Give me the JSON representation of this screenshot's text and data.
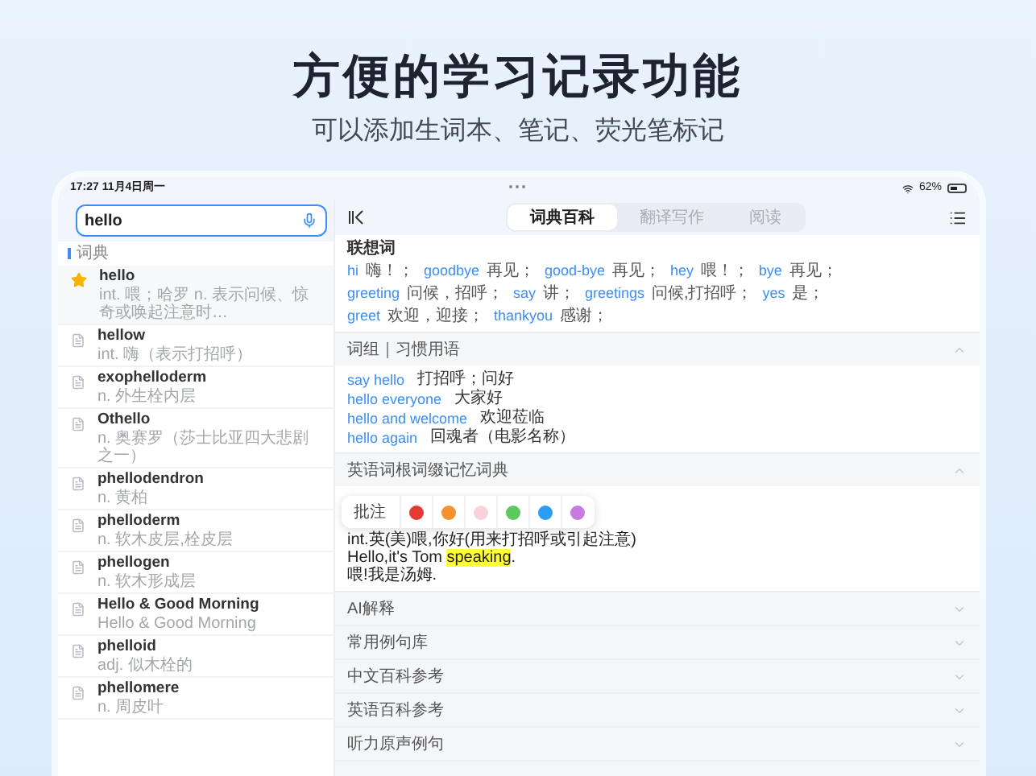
{
  "header": {
    "title": "方便的学习记录功能",
    "subtitle": "可以添加生词本、笔记、荧光笔标记"
  },
  "status": {
    "time": "17:27",
    "date": "11月4日周一",
    "battery": "62%"
  },
  "search": {
    "value": "hello"
  },
  "list_label": "词典",
  "entries": [
    {
      "word": "hello",
      "definition": "int. 喂；哈罗 n. 表示问候、惊奇或唤起注意时…",
      "starred": true
    },
    {
      "word": "hellow",
      "definition": "int. 嗨（表示打招呼）",
      "starred": false
    },
    {
      "word": "exophelloderm",
      "definition": "n. 外生栓内层",
      "starred": false
    },
    {
      "word": "Othello",
      "definition": "n. 奥赛罗（莎士比亚四大悲剧之一）",
      "starred": false
    },
    {
      "word": "phellodendron",
      "definition": "n. 黄柏",
      "starred": false
    },
    {
      "word": "phelloderm",
      "definition": "n. 软木皮层,栓皮层",
      "starred": false
    },
    {
      "word": "phellogen",
      "definition": "n. 软木形成层",
      "starred": false
    },
    {
      "word": "Hello & Good Morning",
      "definition": "Hello & Good Morning",
      "starred": false
    },
    {
      "word": "phelloid",
      "definition": "adj. 似木栓的",
      "starred": false
    },
    {
      "word": "phellomere",
      "definition": "n. 周皮叶",
      "starred": false
    }
  ],
  "tabs": [
    {
      "label": "词典百科",
      "selected": true
    },
    {
      "label": "翻译写作",
      "selected": false
    },
    {
      "label": "阅读",
      "selected": false
    }
  ],
  "associations": {
    "title": "联想词",
    "items": [
      {
        "word": "hi",
        "meaning": "嗨！；"
      },
      {
        "word": "goodbye",
        "meaning": "再见；"
      },
      {
        "word": "good-bye",
        "meaning": "再见；"
      },
      {
        "word": "hey",
        "meaning": "喂！；"
      },
      {
        "word": "bye",
        "meaning": "再见；"
      },
      {
        "word": "greeting",
        "meaning": "问候，招呼；"
      },
      {
        "word": "say",
        "meaning": "讲；"
      },
      {
        "word": "greetings",
        "meaning": "问候,打招呼；"
      },
      {
        "word": "yes",
        "meaning": "是；"
      },
      {
        "word": "greet",
        "meaning": "欢迎，迎接；"
      },
      {
        "word": "thankyou",
        "meaning": "感谢；"
      }
    ]
  },
  "sections": [
    {
      "kind": "phrases",
      "title": "词组｜习惯用语",
      "expanded": true,
      "items": [
        {
          "phrase": "say hello",
          "meaning": "打招呼；问好"
        },
        {
          "phrase": "hello everyone",
          "meaning": "大家好"
        },
        {
          "phrase": "hello and welcome",
          "meaning": "欢迎莅临"
        },
        {
          "phrase": "hello again",
          "meaning": "回魂者（电影名称）"
        }
      ]
    },
    {
      "kind": "notes",
      "title": "英语词根词缀记忆词典",
      "expanded": true,
      "toolbar": {
        "label": "批注",
        "colors": [
          {
            "color": "#e53935"
          },
          {
            "color": "#f5922f"
          },
          {
            "color": "#f9d3dc"
          },
          {
            "color": "#5cc95c"
          },
          {
            "color": "#2a9df4"
          },
          {
            "color": "#c77be0"
          }
        ]
      },
      "lines": [
        [
          {
            "text": "int.英(美)喂,你好(用来打招呼或引起注意)",
            "highlighted": false
          }
        ],
        [
          {
            "text": "Hello,it's Tom ",
            "highlighted": false
          },
          {
            "text": "speaking",
            "highlighted": true
          },
          {
            "text": ".",
            "highlighted": false
          }
        ],
        [
          {
            "text": "喂!我是汤姆.",
            "highlighted": false
          }
        ]
      ]
    },
    {
      "title": "AI解释",
      "expanded": false
    },
    {
      "title": "常用例句库",
      "expanded": false
    },
    {
      "title": "中文百科参考",
      "expanded": false
    },
    {
      "title": "英语百科参考",
      "expanded": false
    },
    {
      "title": "听力原声例句",
      "expanded": false
    }
  ]
}
